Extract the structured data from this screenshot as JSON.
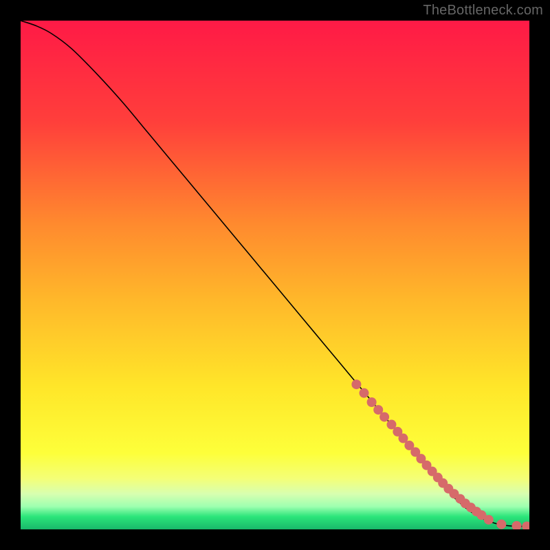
{
  "attribution": "TheBottleneck.com",
  "chart_data": {
    "type": "line",
    "title": "",
    "xlabel": "",
    "ylabel": "",
    "xlim": [
      0,
      100
    ],
    "ylim": [
      0,
      100
    ],
    "background_gradient": {
      "stops": [
        {
          "offset": 0.0,
          "color": "#ff1a46"
        },
        {
          "offset": 0.2,
          "color": "#ff3f3b"
        },
        {
          "offset": 0.4,
          "color": "#ff8a2e"
        },
        {
          "offset": 0.55,
          "color": "#ffb82a"
        },
        {
          "offset": 0.72,
          "color": "#ffe629"
        },
        {
          "offset": 0.85,
          "color": "#fdff3a"
        },
        {
          "offset": 0.9,
          "color": "#f4ff77"
        },
        {
          "offset": 0.93,
          "color": "#d8ffb0"
        },
        {
          "offset": 0.955,
          "color": "#9effb0"
        },
        {
          "offset": 0.975,
          "color": "#2be57a"
        },
        {
          "offset": 1.0,
          "color": "#19b86a"
        }
      ]
    },
    "series": [
      {
        "name": "bottleneck-curve",
        "color": "#000000",
        "x": [
          0,
          3,
          6,
          10,
          15,
          20,
          25,
          30,
          35,
          40,
          45,
          50,
          55,
          60,
          65,
          70,
          75,
          80,
          83,
          86,
          88,
          90,
          92,
          94,
          96,
          98,
          100
        ],
        "y": [
          100,
          99,
          97.5,
          94.5,
          89.5,
          84,
          78,
          72,
          66,
          60,
          54,
          48,
          42,
          36,
          30,
          24,
          18,
          12,
          8.5,
          5.5,
          3.8,
          2.5,
          1.6,
          1.0,
          0.7,
          0.6,
          0.6
        ]
      }
    ],
    "marker_points": {
      "name": "highlight-dots",
      "color": "#d66a6a",
      "radius_px": 7,
      "x": [
        66,
        67.5,
        69,
        70.3,
        71.5,
        72.9,
        74.1,
        75.2,
        76.4,
        77.6,
        78.7,
        79.8,
        80.9,
        82.0,
        83.0,
        84.1,
        85.2,
        86.4,
        87.4,
        88.5,
        89.6,
        90.6,
        92.0,
        94.5,
        97.5,
        99.5
      ],
      "y": [
        28.5,
        26.8,
        25.0,
        23.5,
        22.1,
        20.6,
        19.2,
        17.9,
        16.5,
        15.2,
        13.9,
        12.6,
        11.4,
        10.2,
        9.1,
        8.0,
        7.0,
        6.0,
        5.1,
        4.3,
        3.5,
        2.8,
        1.9,
        1.0,
        0.7,
        0.6
      ]
    }
  }
}
